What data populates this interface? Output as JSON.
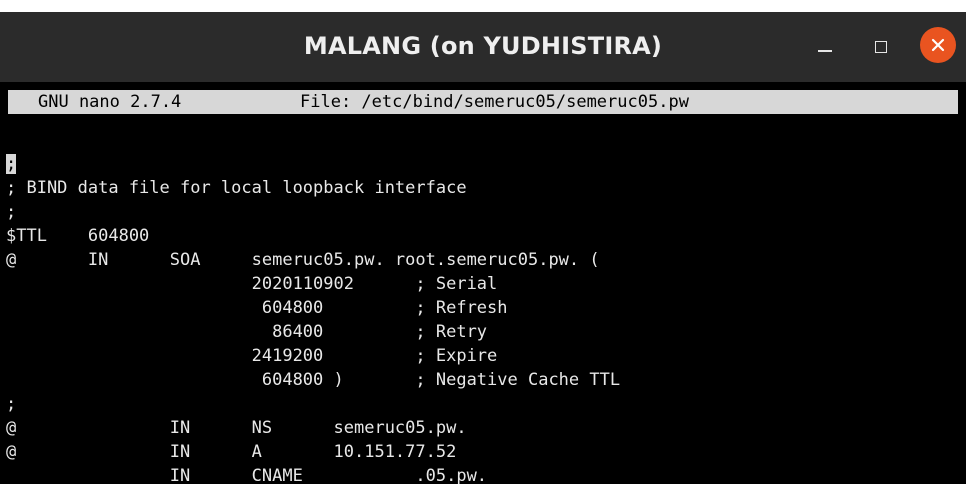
{
  "window": {
    "title": "MALANG (on YUDHISTIRA)",
    "accent_color": "#e95420",
    "buttons": [
      "minimize-icon",
      "maximize-icon",
      "close-icon"
    ]
  },
  "nano": {
    "version": "GNU nano 2.7.4",
    "file": "File: /etc/bind/semeruc05/semeruc05.pw"
  },
  "editor": {
    "cursor_char": ";",
    "lines": [
      "",
      "",
      "; BIND data file for local loopback interface",
      ";",
      "$TTL    604800",
      "@       IN      SOA     semeruc05.pw. root.semeruc05.pw. (",
      "                        2020110902      ; Serial",
      "                         604800         ; Refresh",
      "                          86400         ; Retry",
      "                        2419200         ; Expire",
      "                         604800 )       ; Negative Cache TTL",
      ";",
      "@               IN      NS      semeruc05.pw.",
      "@               IN      A       10.151.77.52",
      "                IN      CNAME           .05.pw."
    ]
  }
}
